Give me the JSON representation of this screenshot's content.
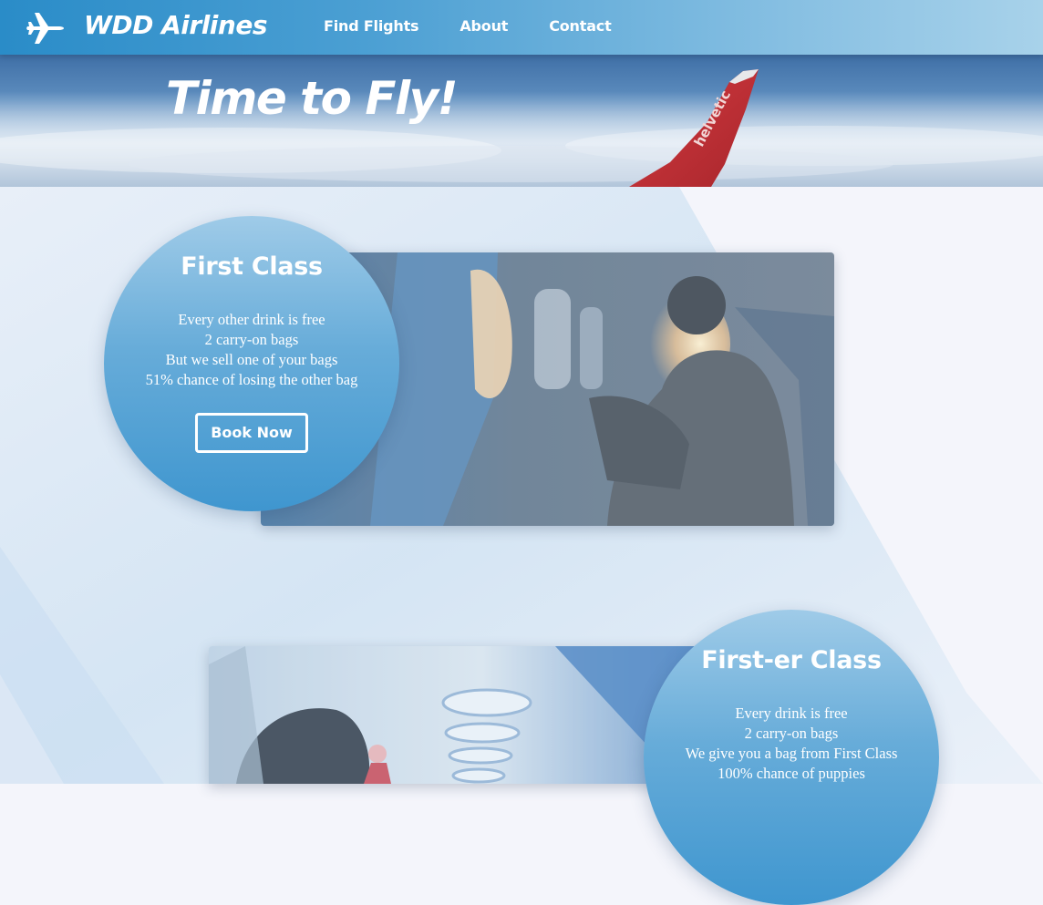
{
  "header": {
    "brand": "WDD Airlines",
    "logo_icon": "airplane-icon",
    "nav": [
      {
        "label": "Find Flights"
      },
      {
        "label": "About"
      },
      {
        "label": "Contact"
      }
    ]
  },
  "hero": {
    "title": "Time to Fly!",
    "wing_text": "helvetic"
  },
  "cards": [
    {
      "title": "First Class",
      "features": [
        "Every other drink is free",
        "2 carry-on bags",
        "But we sell one of your bags",
        "51% chance of losing the other bag"
      ],
      "button_label": "Book Now"
    },
    {
      "title": "First-er Class",
      "features": [
        "Every drink is free",
        "2 carry-on bags",
        "We give you a bag from First Class",
        "100% chance of puppies"
      ]
    }
  ],
  "colors": {
    "header_start": "#2a8cc8",
    "header_end": "#a8d2ea",
    "circle_top": "#9fcbe8",
    "circle_bottom": "#3f96cf",
    "page_bg": "#f4f5fb"
  }
}
